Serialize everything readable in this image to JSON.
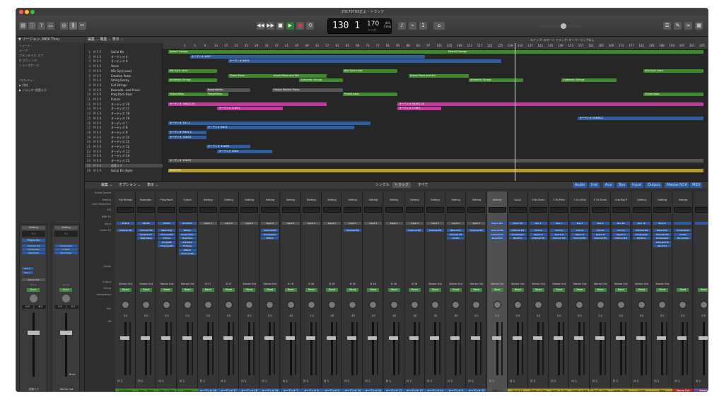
{
  "window": {
    "title": "20170703正よ - トラック"
  },
  "colors": {
    "green": "#3f8a2a",
    "pink": "#c23aa0",
    "blue": "#2f5d9e",
    "yellow": "#b49a2a",
    "gray": "#555555"
  },
  "lcd": {
    "bar": "130 1",
    "tempo": "170",
    "tempo_label": "テンポ",
    "sig_top": "4/4",
    "sig_bottom": "Cmaj"
  },
  "inspector": {
    "header": "▼ リージョン: MIDI Thru",
    "rows": [
      "ミュート:",
      "ループ:",
      "クオンタイズ: オフ",
      "Q-スウィング:",
      "トランスポーズ:",
      "ベロシティ:",
      "▶ 詳細",
      "▶ トラック: 初音ミク"
    ],
    "strip1": {
      "setting": "Setting",
      "eq": "EQ",
      "input": "Plapro Stu",
      "fx": [
        "Channel EQ",
        "Compressor",
        "SilverVerb"
      ],
      "sends": [
        "Bus 1",
        "Bus 3"
      ],
      "out": "Stereo Out",
      "group": "Group",
      "read": "Read",
      "vol": "0.0",
      "pk": "-8.2",
      "name": "初音ミク"
    },
    "strip2": {
      "setting": "Setting",
      "eq": "EQ",
      "fx": [
        "Compressor",
        "Limiter",
        "W1 Limiter"
      ],
      "out": "",
      "group": "Group",
      "read": "Read",
      "vol": "0.0",
      "pk": "-0.1",
      "name": "Stereo Out",
      "bnce": "Bnce"
    }
  },
  "tracklist": {
    "header": "編集 ⌄  機能 ⌄  表示 ⌄",
    "tracks": [
      {
        "n": "1",
        "name": "SoCal Kit"
      },
      {
        "n": "2",
        "name": "オーディオ 4"
      },
      {
        "n": "3",
        "name": "オーディオ 6"
      },
      {
        "n": "4",
        "name": "Vocal"
      },
      {
        "n": "5",
        "name": "80s Sync Lead"
      },
      {
        "n": "6",
        "name": "Emotive Pulse"
      },
      {
        "n": "7",
        "name": "String Decay"
      },
      {
        "n": "8",
        "name": "Full Strings"
      },
      {
        "n": "9",
        "name": "Bosendo...and Piano"
      },
      {
        "n": "10",
        "name": "Prog Rock Bass"
      },
      {
        "n": "11",
        "name": "Future"
      },
      {
        "n": "12",
        "name": "オーディオ 16"
      },
      {
        "n": "13",
        "name": "オーディオ 17"
      },
      {
        "n": "14",
        "name": "オーディオ 18"
      },
      {
        "n": "15",
        "name": "オーディオ 19"
      },
      {
        "n": "16",
        "name": "オーディオ 7"
      },
      {
        "n": "17",
        "name": "オーディオ 8"
      },
      {
        "n": "18",
        "name": "オーディオ 9"
      },
      {
        "n": "19",
        "name": "オーディオ 10"
      },
      {
        "n": "20",
        "name": "オーディオ 11"
      },
      {
        "n": "21",
        "name": "オーディオ 12"
      },
      {
        "n": "22",
        "name": "オーディオ 13"
      },
      {
        "n": "23",
        "name": "オーディオ 14"
      },
      {
        "n": "24",
        "name": "オーディオ 15"
      },
      {
        "n": "25",
        "name": "初音ミク"
      },
      {
        "n": "26",
        "name": "SoCal Kit (Kyle)"
      }
    ]
  },
  "arrange": {
    "header": "スナップ: スマート    ドラッグ: オーバーラップなし",
    "ruler": [
      "1",
      "5",
      "9",
      "13",
      "17",
      "21",
      "25",
      "29",
      "33",
      "37",
      "41",
      "45",
      "49",
      "53",
      "57",
      "61",
      "65",
      "69",
      "73",
      "77",
      "81",
      "85",
      "89",
      "93",
      "97",
      "101",
      "105",
      "109",
      "113",
      "117",
      "121",
      "125",
      "129",
      "133",
      "137",
      "141",
      "145",
      "149",
      "153",
      "157",
      "161",
      "165",
      "169",
      "173",
      "177",
      "181",
      "185",
      "189",
      "193",
      "197",
      "201",
      "205"
    ],
    "regions": [
      {
        "r": 0,
        "s": 0.01,
        "e": 0.52,
        "c": "green",
        "t": "Detroit Garage"
      },
      {
        "r": 0,
        "s": 0.52,
        "e": 0.99,
        "c": "green",
        "t": "Detroit Garage"
      },
      {
        "r": 1,
        "s": 0.05,
        "e": 0.48,
        "c": "blue",
        "t": "オーディオ 4#07"
      },
      {
        "r": 2,
        "s": 0.12,
        "e": 0.62,
        "c": "blue",
        "t": "オーディオ 6#02"
      },
      {
        "r": 4,
        "s": 0.01,
        "e": 0.1,
        "c": "green",
        "t": "80s Sync Lead"
      },
      {
        "r": 4,
        "s": 0.33,
        "e": 0.43,
        "c": "green",
        "t": "80s Sync Lead"
      },
      {
        "r": 4,
        "s": 0.88,
        "e": 0.99,
        "c": "green",
        "t": "80s Sync Lead"
      },
      {
        "r": 5,
        "s": 0.12,
        "e": 0.2,
        "c": "green",
        "t": "Grand Piano"
      },
      {
        "r": 5,
        "s": 0.2,
        "e": 0.3,
        "c": "green",
        "t": "Grand Piano and Stri"
      },
      {
        "r": 5,
        "s": 0.45,
        "e": 0.56,
        "c": "green",
        "t": "Grand Piano and Stri"
      },
      {
        "r": 6,
        "s": 0.01,
        "e": 0.1,
        "c": "green",
        "t": "Authentic Strings"
      },
      {
        "r": 6,
        "s": 0.25,
        "e": 0.33,
        "c": "green",
        "t": "Authentic Strings"
      },
      {
        "r": 6,
        "s": 0.56,
        "e": 0.66,
        "c": "green",
        "t": "Authentic Strings"
      },
      {
        "r": 6,
        "s": 0.73,
        "e": 0.83,
        "c": "green",
        "t": "Authentic Strings"
      },
      {
        "r": 8,
        "s": 0.08,
        "e": 0.16,
        "c": "gray",
        "t": "Bosendorfer"
      },
      {
        "r": 8,
        "s": 0.2,
        "e": 0.33,
        "c": "gray",
        "t": "Classic Electric Piano"
      },
      {
        "r": 9,
        "s": 0.01,
        "e": 0.08,
        "c": "green",
        "t": "Picked Bass"
      },
      {
        "r": 9,
        "s": 0.08,
        "e": 0.12,
        "c": "green",
        "t": "Picked Bass"
      },
      {
        "r": 9,
        "s": 0.33,
        "e": 0.43,
        "c": "green",
        "t": "Picked Bass"
      },
      {
        "r": 9,
        "s": 0.88,
        "e": 0.99,
        "c": "green",
        "t": "Picked Bass"
      },
      {
        "r": 11,
        "s": 0.01,
        "e": 0.3,
        "c": "pink",
        "t": "オーディオ 16#02.20"
      },
      {
        "r": 11,
        "s": 0.43,
        "e": 0.99,
        "c": "pink",
        "t": "オーディオ 16#02.16"
      },
      {
        "r": 12,
        "s": 0.1,
        "e": 0.22,
        "c": "pink",
        "t": "オーディオ 17#01"
      },
      {
        "r": 12,
        "s": 0.43,
        "e": 0.51,
        "c": "pink",
        "t": "オーディオ 17#01"
      },
      {
        "r": 14,
        "s": 0.76,
        "e": 0.99,
        "c": "blue",
        "t": "オーディオ 19#08.2"
      },
      {
        "r": 15,
        "s": 0.01,
        "e": 0.38,
        "c": "blue",
        "t": "オーディオ 7#7.2"
      },
      {
        "r": 16,
        "s": 0.08,
        "e": 0.35,
        "c": "blue",
        "t": "オーディオ 8#01"
      },
      {
        "r": 17,
        "s": 0.01,
        "e": 0.08,
        "c": "blue",
        "t": "オーディオ 9#02.2"
      },
      {
        "r": 18,
        "s": 0.01,
        "e": 0.08,
        "c": "blue",
        "t": "オーディオ 10#03"
      },
      {
        "r": 20,
        "s": 0.08,
        "e": 0.16,
        "c": "blue",
        "t": "オーディオ 12#03"
      },
      {
        "r": 21,
        "s": 0.1,
        "e": 0.2,
        "c": "blue",
        "t": "オーディオ 13#0"
      },
      {
        "r": 23,
        "s": 0.01,
        "e": 0.99,
        "c": "gray",
        "t": "オーディオ 15#03"
      },
      {
        "r": 25,
        "s": 0.01,
        "e": 0.99,
        "c": "yellow",
        "t": "Drummer"
      }
    ]
  },
  "mixer": {
    "tabs": [
      "編集 ⌄",
      "オプション ⌄",
      "表示 ⌄"
    ],
    "views": [
      "シングル",
      "トラック",
      "すべて"
    ],
    "filters": [
      "Audio",
      "Inst",
      "Aux",
      "Bus",
      "Input",
      "Output",
      "Master/VCA",
      "MIDI"
    ],
    "row_labels": [
      "Audio Device",
      "Setting",
      "Gain Reduction",
      "EQ",
      "MIDI FX",
      "Input",
      "Audio FX",
      "Sends",
      "Output",
      "Group",
      "Automation",
      "Pan",
      "dB"
    ],
    "channels": [
      {
        "name": "Full Strings",
        "top": "Full Strings",
        "in": "EXS24",
        "fx": [
          "Channel EQ"
        ],
        "out": "Stereo Out",
        "c": "green",
        "vol": "0.0"
      },
      {
        "name": "Boes...Piano",
        "top": "Bosendo..",
        "in": "EXS24",
        "fx": [
          "Channel EQ",
          "Compressor",
          "Tape Delay"
        ],
        "out": "Stereo Out",
        "c": "green",
        "vol": "0.0"
      },
      {
        "name": "Prog...k Bass",
        "top": "Prog Rock",
        "in": "EXS24",
        "fx": [
          "Bass Amp",
          "Channel EQ",
          "Chorus",
          "RingShift",
          "Channel EQ"
        ],
        "out": "Stereo Out",
        "c": "green",
        "vol": "0.0"
      },
      {
        "name": "Future",
        "top": "Future",
        "in": "DrmMchn",
        "fx": [
          "Multipr",
          "Compressor",
          "Overdrive",
          "AutoFilter",
          "St-Delay",
          "PtVerb",
          "Channel EQ"
        ],
        "out": "Stereo Out",
        "c": "green",
        "vol": "0.0"
      },
      {
        "name": "オーディオ 16",
        "top": "Setting",
        "in": "Input 3",
        "fx": [],
        "out": "B 17",
        "c": "blue",
        "vol": "0.0"
      },
      {
        "name": "オーディオ 17",
        "top": "Setting",
        "in": "Input 3",
        "fx": [],
        "out": "B 17",
        "c": "blue",
        "vol": "0.0"
      },
      {
        "name": "オーディオ 18",
        "top": "Setting",
        "in": "Input 3",
        "fx": [],
        "out": "Stereo Out",
        "c": "blue",
        "vol": "0.0"
      },
      {
        "name": "オーディオ 19",
        "top": "Setting",
        "in": "Input 3",
        "fx": [
          "Channel EQ",
          "Compressor",
          "PtVerb"
        ],
        "out": "Stereo Out",
        "c": "blue",
        "vol": "0.0"
      },
      {
        "name": "オーディオ 7",
        "top": "Setting",
        "in": "Input 3",
        "fx": [],
        "out": "B 16",
        "c": "blue",
        "vol": "-40"
      },
      {
        "name": "オーディオ 8",
        "top": "Setting",
        "in": "Input 3",
        "fx": [],
        "out": "B 16",
        "c": "blue",
        "vol": "-7.0"
      },
      {
        "name": "オーディオ 9",
        "top": "Setting",
        "in": "Input 3",
        "fx": [],
        "out": "B 16",
        "c": "blue",
        "vol": "-40"
      },
      {
        "name": "オーディオ 10",
        "top": "Setting",
        "in": "Input 3",
        "fx": [
          "Channel EQ"
        ],
        "out": "B 16",
        "c": "blue",
        "vol": "-40"
      },
      {
        "name": "オーディオ 11",
        "top": "Setting",
        "in": "Input 3",
        "fx": [],
        "out": "B 16",
        "c": "blue",
        "vol": "-40"
      },
      {
        "name": "オーディオ 12",
        "top": "Setting",
        "in": "Input 3",
        "fx": [],
        "out": "B 16",
        "c": "blue",
        "vol": "-40"
      },
      {
        "name": "オーディオ 13",
        "top": "Setting",
        "in": "Input 3",
        "fx": [
          "Channel EQ"
        ],
        "out": "B 16",
        "c": "blue",
        "vol": "-40"
      },
      {
        "name": "オーディオ 14",
        "top": "Setting",
        "in": "Input 3",
        "fx": [
          "Channel EQ"
        ],
        "out": "Stereo Out",
        "c": "blue",
        "vol": "-30"
      },
      {
        "name": "オーディオ 5",
        "top": "Setting",
        "in": "Input 3",
        "fx": [
          "Bass Amp",
          "Channel EQ",
          "Limiter"
        ],
        "out": "Stereo Out",
        "c": "blue",
        "vol": "-30"
      },
      {
        "name": "オーディオ 15",
        "top": "Setting",
        "in": "Input 3",
        "fx": [
          "Channel EQ"
        ],
        "out": "Stereo Out",
        "c": "blue",
        "vol": "0.0"
      },
      {
        "name": "初音ミク",
        "top": "Setting",
        "in": "Plapro Stu",
        "fx": [
          "Channel EQ",
          "Compressor",
          "SilverVerb"
        ],
        "out": "Stereo Out",
        "c": "gray",
        "vol": "0.0"
      },
      {
        "name": "SoCal Kit",
        "top": "SoCal",
        "in": "Drum Kit",
        "fx": [
          "Channel EQ",
          "Compressor",
          "Neutrino"
        ],
        "out": "Stereo Out",
        "c": "yellow",
        "vol": "0.0"
      },
      {
        "name": "Small...h Four",
        "top": "0.6s Drum",
        "in": "Bus 1",
        "fx": [
          "Chorus",
          "Space D",
          "Channel EQ"
        ],
        "out": "Stereo Out",
        "c": "yellow",
        "vol": "0.0"
      },
      {
        "name": "Large...h One",
        "top": "2.5s Princ",
        "in": "Bus 2",
        "fx": [
          "Chorus",
          "Space D",
          "Channel EQ"
        ],
        "out": "Stereo Out",
        "c": "yellow",
        "vol": "0.0"
      },
      {
        "name": "Small...e Hall",
        "top": "1.3s (Vfus",
        "in": "Bus 3",
        "fx": [
          "Chorus",
          "Space D",
          "Channel EQ"
        ],
        "out": "Stereo Out",
        "c": "yellow",
        "vol": "0.0"
      },
      {
        "name": "Small...Plate",
        "top": "0.7s Drum",
        "in": "Bus 4",
        "fx": [
          "Chorus",
          "Space D",
          "Channel EQ"
        ],
        "out": "Stereo Out",
        "c": "yellow",
        "vol": "0.0"
      },
      {
        "name": "Large...Plate",
        "top": "4.4s Big P",
        "in": "Bus 16",
        "fx": [
          "Chorus",
          "Space D",
          "Channel EQ"
        ],
        "out": "Stereo Out",
        "c": "yellow",
        "vol": "0.0"
      },
      {
        "name": "Guitar",
        "top": "Setting",
        "in": "Bus 16",
        "fx": [
          "Channel EQ",
          "Compressor",
          "Neutrino"
        ],
        "out": "Stereo Out",
        "c": "yellow",
        "vol": "0.0"
      },
      {
        "name": "Bass",
        "top": "Setting",
        "in": "Bus 17",
        "fx": [
          "Bass Amp",
          "Channel EQ",
          "Compressor",
          "AUGraphicE",
          "Neutrino"
        ],
        "out": "Stereo Out",
        "c": "yellow",
        "vol": "0.0"
      },
      {
        "name": "Stereo Out",
        "top": "Setting",
        "in": "",
        "fx": [
          "Compressor",
          "Limiter",
          "W1 Limiter"
        ],
        "out": "",
        "c": "red",
        "vol": "0.0"
      },
      {
        "name": "Master",
        "top": "",
        "in": "",
        "fx": [],
        "out": "",
        "c": "violet",
        "vol": "0.0"
      }
    ]
  }
}
